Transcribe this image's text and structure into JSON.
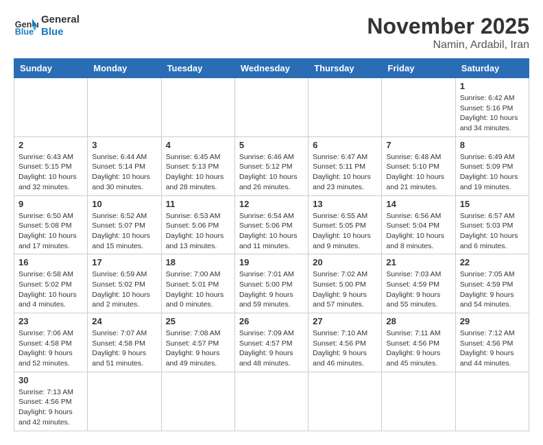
{
  "logo": {
    "text_general": "General",
    "text_blue": "Blue"
  },
  "header": {
    "month_title": "November 2025",
    "location": "Namin, Ardabil, Iran"
  },
  "weekdays": [
    "Sunday",
    "Monday",
    "Tuesday",
    "Wednesday",
    "Thursday",
    "Friday",
    "Saturday"
  ],
  "weeks": [
    [
      {
        "day": "",
        "info": ""
      },
      {
        "day": "",
        "info": ""
      },
      {
        "day": "",
        "info": ""
      },
      {
        "day": "",
        "info": ""
      },
      {
        "day": "",
        "info": ""
      },
      {
        "day": "",
        "info": ""
      },
      {
        "day": "1",
        "info": "Sunrise: 6:42 AM\nSunset: 5:16 PM\nDaylight: 10 hours and 34 minutes."
      }
    ],
    [
      {
        "day": "2",
        "info": "Sunrise: 6:43 AM\nSunset: 5:15 PM\nDaylight: 10 hours and 32 minutes."
      },
      {
        "day": "3",
        "info": "Sunrise: 6:44 AM\nSunset: 5:14 PM\nDaylight: 10 hours and 30 minutes."
      },
      {
        "day": "4",
        "info": "Sunrise: 6:45 AM\nSunset: 5:13 PM\nDaylight: 10 hours and 28 minutes."
      },
      {
        "day": "5",
        "info": "Sunrise: 6:46 AM\nSunset: 5:12 PM\nDaylight: 10 hours and 26 minutes."
      },
      {
        "day": "6",
        "info": "Sunrise: 6:47 AM\nSunset: 5:11 PM\nDaylight: 10 hours and 23 minutes."
      },
      {
        "day": "7",
        "info": "Sunrise: 6:48 AM\nSunset: 5:10 PM\nDaylight: 10 hours and 21 minutes."
      },
      {
        "day": "8",
        "info": "Sunrise: 6:49 AM\nSunset: 5:09 PM\nDaylight: 10 hours and 19 minutes."
      }
    ],
    [
      {
        "day": "9",
        "info": "Sunrise: 6:50 AM\nSunset: 5:08 PM\nDaylight: 10 hours and 17 minutes."
      },
      {
        "day": "10",
        "info": "Sunrise: 6:52 AM\nSunset: 5:07 PM\nDaylight: 10 hours and 15 minutes."
      },
      {
        "day": "11",
        "info": "Sunrise: 6:53 AM\nSunset: 5:06 PM\nDaylight: 10 hours and 13 minutes."
      },
      {
        "day": "12",
        "info": "Sunrise: 6:54 AM\nSunset: 5:06 PM\nDaylight: 10 hours and 11 minutes."
      },
      {
        "day": "13",
        "info": "Sunrise: 6:55 AM\nSunset: 5:05 PM\nDaylight: 10 hours and 9 minutes."
      },
      {
        "day": "14",
        "info": "Sunrise: 6:56 AM\nSunset: 5:04 PM\nDaylight: 10 hours and 8 minutes."
      },
      {
        "day": "15",
        "info": "Sunrise: 6:57 AM\nSunset: 5:03 PM\nDaylight: 10 hours and 6 minutes."
      }
    ],
    [
      {
        "day": "16",
        "info": "Sunrise: 6:58 AM\nSunset: 5:02 PM\nDaylight: 10 hours and 4 minutes."
      },
      {
        "day": "17",
        "info": "Sunrise: 6:59 AM\nSunset: 5:02 PM\nDaylight: 10 hours and 2 minutes."
      },
      {
        "day": "18",
        "info": "Sunrise: 7:00 AM\nSunset: 5:01 PM\nDaylight: 10 hours and 0 minutes."
      },
      {
        "day": "19",
        "info": "Sunrise: 7:01 AM\nSunset: 5:00 PM\nDaylight: 9 hours and 59 minutes."
      },
      {
        "day": "20",
        "info": "Sunrise: 7:02 AM\nSunset: 5:00 PM\nDaylight: 9 hours and 57 minutes."
      },
      {
        "day": "21",
        "info": "Sunrise: 7:03 AM\nSunset: 4:59 PM\nDaylight: 9 hours and 55 minutes."
      },
      {
        "day": "22",
        "info": "Sunrise: 7:05 AM\nSunset: 4:59 PM\nDaylight: 9 hours and 54 minutes."
      }
    ],
    [
      {
        "day": "23",
        "info": "Sunrise: 7:06 AM\nSunset: 4:58 PM\nDaylight: 9 hours and 52 minutes."
      },
      {
        "day": "24",
        "info": "Sunrise: 7:07 AM\nSunset: 4:58 PM\nDaylight: 9 hours and 51 minutes."
      },
      {
        "day": "25",
        "info": "Sunrise: 7:08 AM\nSunset: 4:57 PM\nDaylight: 9 hours and 49 minutes."
      },
      {
        "day": "26",
        "info": "Sunrise: 7:09 AM\nSunset: 4:57 PM\nDaylight: 9 hours and 48 minutes."
      },
      {
        "day": "27",
        "info": "Sunrise: 7:10 AM\nSunset: 4:56 PM\nDaylight: 9 hours and 46 minutes."
      },
      {
        "day": "28",
        "info": "Sunrise: 7:11 AM\nSunset: 4:56 PM\nDaylight: 9 hours and 45 minutes."
      },
      {
        "day": "29",
        "info": "Sunrise: 7:12 AM\nSunset: 4:56 PM\nDaylight: 9 hours and 44 minutes."
      }
    ],
    [
      {
        "day": "30",
        "info": "Sunrise: 7:13 AM\nSunset: 4:56 PM\nDaylight: 9 hours and 42 minutes."
      },
      {
        "day": "",
        "info": ""
      },
      {
        "day": "",
        "info": ""
      },
      {
        "day": "",
        "info": ""
      },
      {
        "day": "",
        "info": ""
      },
      {
        "day": "",
        "info": ""
      },
      {
        "day": "",
        "info": ""
      }
    ]
  ]
}
